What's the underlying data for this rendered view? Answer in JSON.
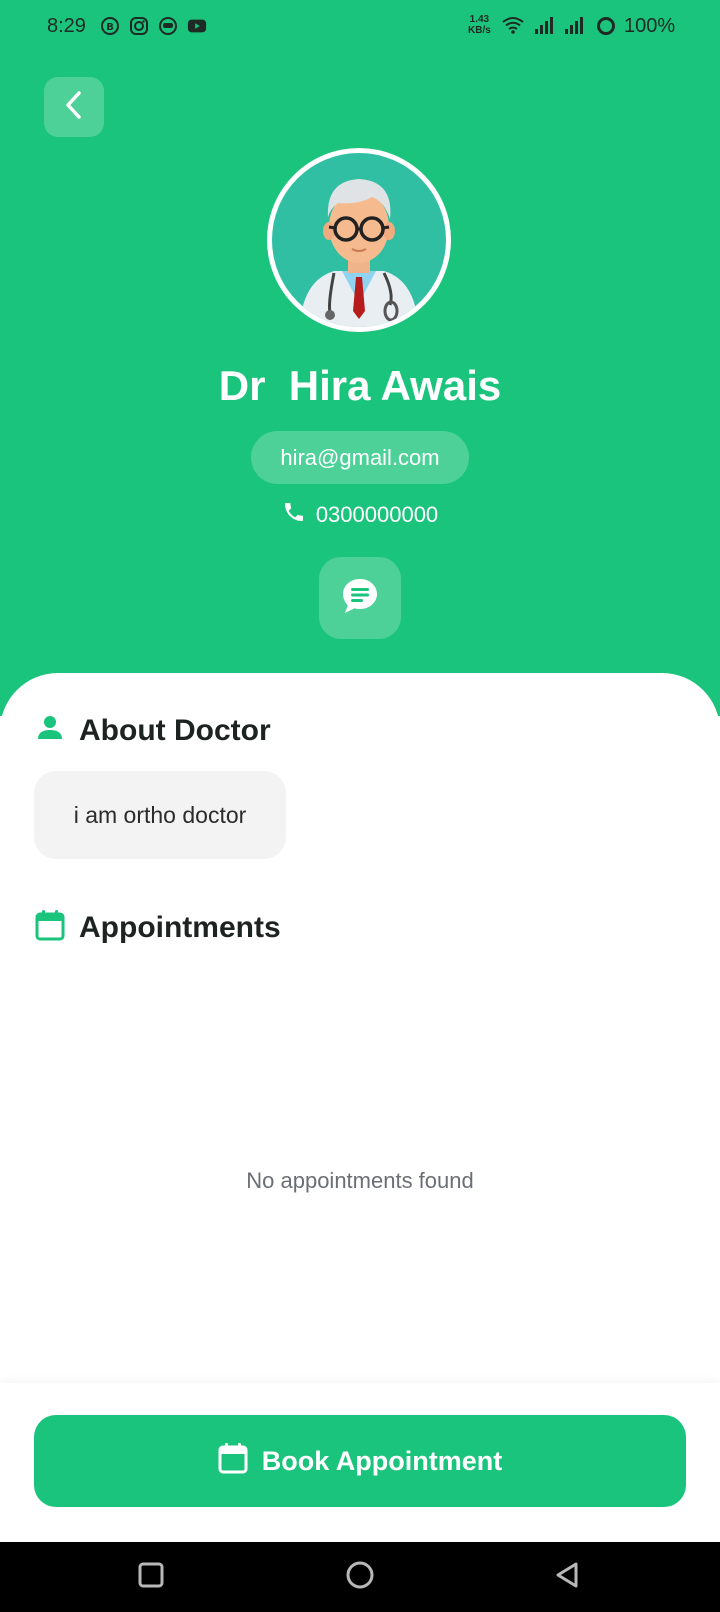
{
  "status_bar": {
    "time": "8:29",
    "net_speed_value": "1.43",
    "net_speed_unit": "KB/s",
    "battery": "100%",
    "app_icons": [
      "b-icon",
      "instagram-icon",
      "robot-icon",
      "youtube-icon"
    ]
  },
  "profile": {
    "name": "Dr  Hira Awais",
    "email": "hira@gmail.com",
    "phone": "0300000000"
  },
  "about": {
    "title": "About Doctor",
    "text": "i am ortho doctor"
  },
  "appointments": {
    "title": "Appointments",
    "empty_text": "No appointments found"
  },
  "actions": {
    "book_label": "Book Appointment"
  },
  "colors": {
    "primary": "#1bc47d",
    "avatar_bg": "#30bfa3",
    "about_bg": "#f3f3f3"
  }
}
